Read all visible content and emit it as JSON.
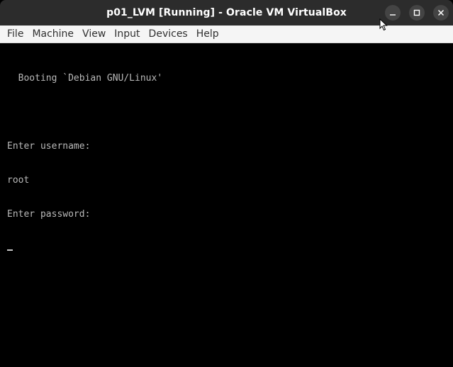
{
  "window": {
    "title": "p01_LVM [Running] - Oracle VM VirtualBox",
    "controls": [
      "minimize-icon",
      "maximize-icon",
      "close-icon"
    ]
  },
  "menubar": {
    "items": [
      {
        "label": "File"
      },
      {
        "label": "Machine"
      },
      {
        "label": "View"
      },
      {
        "label": "Input"
      },
      {
        "label": "Devices"
      },
      {
        "label": "Help"
      }
    ]
  },
  "console": {
    "lines": [
      "  Booting `Debian GNU/Linux'",
      "",
      "Enter username:",
      "root",
      "Enter password:"
    ]
  },
  "colors": {
    "titlebar": "#2c2c2c",
    "menubar": "#f5f5f5",
    "console_bg": "#000000",
    "console_text": "#b9b9b9"
  }
}
